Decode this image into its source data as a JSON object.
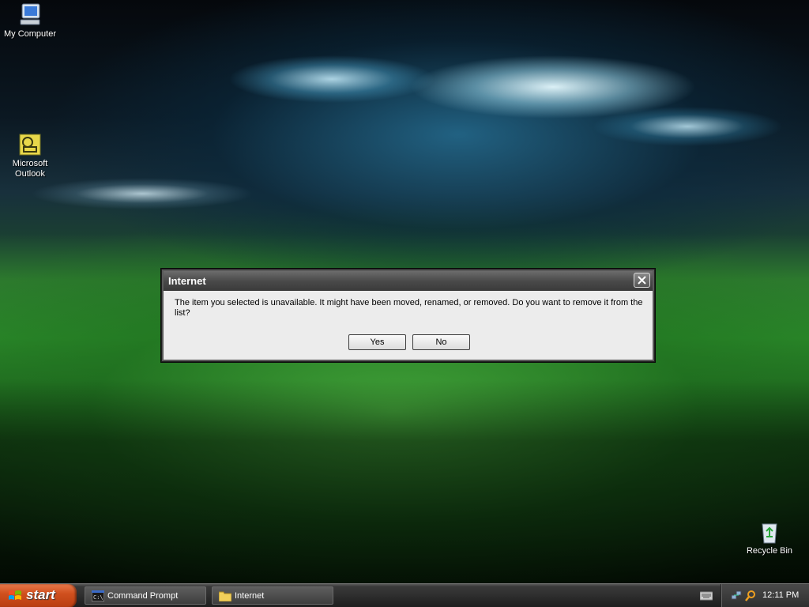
{
  "desktop": {
    "icons": [
      {
        "label": "My Computer",
        "icon": "my-computer-icon"
      },
      {
        "label": "Microsoft Outlook",
        "icon": "outlook-icon"
      },
      {
        "label": "Recycle Bin",
        "icon": "recycle-bin-icon"
      }
    ]
  },
  "dialog": {
    "title": "Internet",
    "message": "The item you selected is unavailable.  It might have been moved, renamed, or removed.  Do you want to remove it from the list?",
    "yes_label": "Yes",
    "no_label": "No"
  },
  "taskbar": {
    "start_label": "start",
    "tasks": [
      {
        "label": "Command Prompt",
        "icon": "command-prompt-icon"
      },
      {
        "label": "Internet",
        "icon": "folder-icon"
      }
    ],
    "clock": "12:11 PM"
  },
  "colors": {
    "dialog_title_bar": "#4a4a4a",
    "start_button": "#d0501e",
    "taskbar": "#2a2a2a"
  }
}
